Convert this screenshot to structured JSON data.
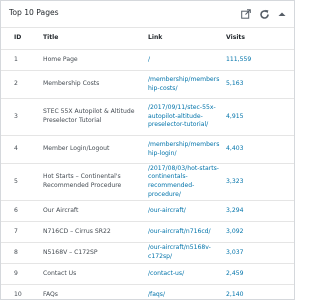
{
  "widget": {
    "title": "Top 10 Pages",
    "icons": [
      "external-link-icon",
      "refresh-icon",
      "collapse-arrow-icon"
    ]
  },
  "table": {
    "headers": {
      "id": "ID",
      "title": "Title",
      "link": "Link",
      "visits": "Visits"
    },
    "rows": [
      {
        "id": "1",
        "title": "Home Page",
        "link": "/",
        "visits": "111,559"
      },
      {
        "id": "2",
        "title": "Membership Costs",
        "link": "/membership/membership-costs/",
        "visits": "5,163"
      },
      {
        "id": "3",
        "title": "STEC 55X Autopilot & Altitude Preselector Tutorial",
        "link": "/2017/09/11/stec-55x-autopilot-altitude-preselector-tutorial/",
        "visits": "4,915"
      },
      {
        "id": "4",
        "title": "Member Login/Logout",
        "link": "/membership/membership-login/",
        "visits": "4,403"
      },
      {
        "id": "5",
        "title": "Hot Starts – Continental's Recommended Procedure",
        "link": "/2017/08/03/hot-starts-continentals-recommended-procedure/",
        "visits": "3,323"
      },
      {
        "id": "6",
        "title": "Our Aircraft",
        "link": "/our-aircraft/",
        "visits": "3,294"
      },
      {
        "id": "7",
        "title": "N716CD – Cirrus SR22",
        "link": "/our-aircraft/n716cd/",
        "visits": "3,092"
      },
      {
        "id": "8",
        "title": "N5168V – C172SP",
        "link": "/our-aircraft/n5168v-c172sp/",
        "visits": "3,037"
      },
      {
        "id": "9",
        "title": "Contact Us",
        "link": "/contact-us/",
        "visits": "2,459"
      },
      {
        "id": "10",
        "title": "FAQs",
        "link": "/faqs/",
        "visits": "2,140"
      }
    ]
  }
}
